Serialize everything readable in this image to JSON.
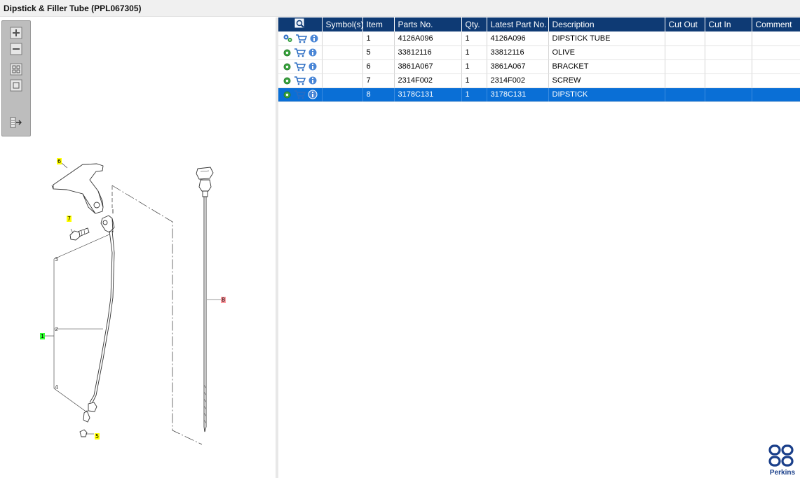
{
  "window": {
    "title": "Dipstick & Filler Tube (PPL067305)"
  },
  "toolbar": {
    "buttons": [
      "zoom-in-icon",
      "zoom-out-icon",
      "fit-all-icon",
      "fit-page-icon",
      "export-list-icon"
    ]
  },
  "diagram": {
    "callouts": {
      "c6": "6",
      "c7": "7",
      "c1": "1",
      "c5": "5",
      "c8": "8",
      "c3": "3",
      "c2": "2",
      "c4": "4"
    }
  },
  "grid": {
    "columns": {
      "symbols": "Symbol(s)",
      "item": "Item",
      "parts_no": "Parts No.",
      "qty": "Qty.",
      "latest_part_no": "Latest Part No.",
      "description": "Description",
      "cut_out": "Cut Out",
      "cut_in": "Cut In",
      "comment": "Comment"
    },
    "rows": [
      {
        "item": "1",
        "parts_no": "4126A096",
        "qty": "1",
        "latest_part_no": "4126A096",
        "description": "DIPSTICK TUBE",
        "cut_out": "",
        "cut_in": "",
        "comment": "",
        "status_icon": "gears-icon"
      },
      {
        "item": "5",
        "parts_no": "33812116",
        "qty": "1",
        "latest_part_no": "33812116",
        "description": "OLIVE",
        "cut_out": "",
        "cut_in": "",
        "comment": "",
        "status_icon": "gear-icon"
      },
      {
        "item": "6",
        "parts_no": "3861A067",
        "qty": "1",
        "latest_part_no": "3861A067",
        "description": "BRACKET",
        "cut_out": "",
        "cut_in": "",
        "comment": "",
        "status_icon": "gear-icon"
      },
      {
        "item": "7",
        "parts_no": "2314F002",
        "qty": "1",
        "latest_part_no": "2314F002",
        "description": "SCREW",
        "cut_out": "",
        "cut_in": "",
        "comment": "",
        "status_icon": "gear-icon"
      },
      {
        "item": "8",
        "parts_no": "3178C131",
        "qty": "1",
        "latest_part_no": "3178C131",
        "description": "DIPSTICK",
        "cut_out": "",
        "cut_in": "",
        "comment": "",
        "status_icon": "gear-icon",
        "selected": true
      }
    ]
  },
  "brand": {
    "name": "Perkins",
    "color": "#1a3f8a"
  },
  "colors": {
    "header": "#0e3a74",
    "selection": "#0a6fd6",
    "callout_yellow": "#ffff00",
    "callout_green": "#33ff33",
    "callout_red": "#ff9aa0"
  }
}
